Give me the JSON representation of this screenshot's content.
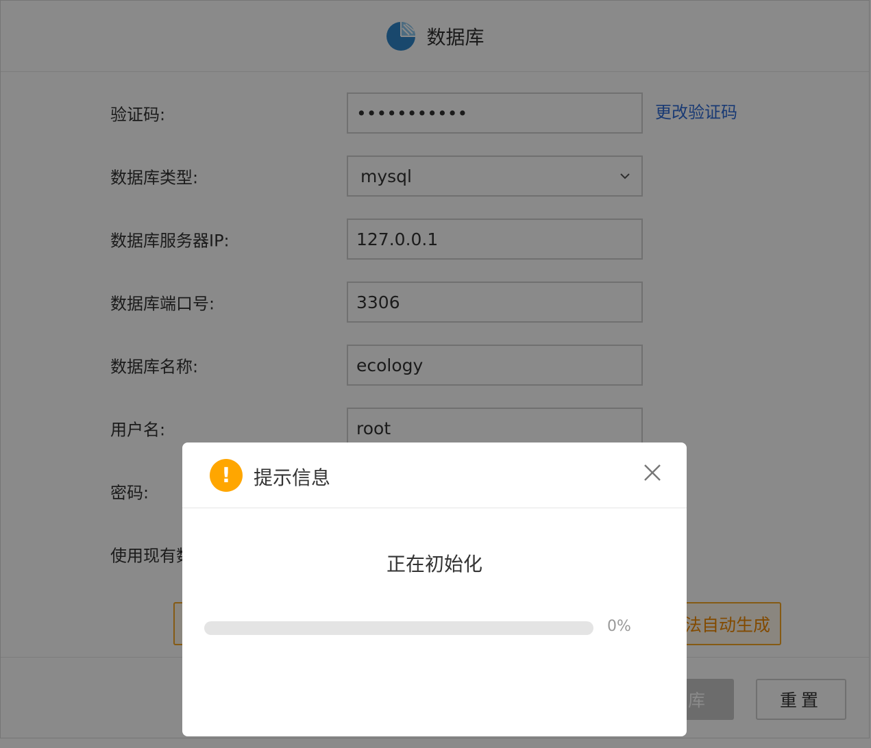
{
  "header": {
    "title": "数据库",
    "logo_icon": "database-pie-icon"
  },
  "form": {
    "verify_code": {
      "label": "验证码:",
      "value": "•••••••••••",
      "change_link": "更改验证码"
    },
    "db_type": {
      "label": "数据库类型:",
      "value": "mysql"
    },
    "server_ip": {
      "label": "数据库服务器IP:",
      "value": "127.0.0.1"
    },
    "port": {
      "label": "数据库端口号:",
      "value": "3306"
    },
    "db_name": {
      "label": "数据库名称:",
      "value": "ecology"
    },
    "username": {
      "label": "用户名:",
      "value": "root"
    },
    "password": {
      "label": "密码:",
      "value": ""
    },
    "use_existing": {
      "label": "使用现有数"
    }
  },
  "buttons": {
    "warning_partial": "法自动生成",
    "create_partial": "库",
    "reset": "重置"
  },
  "dialog": {
    "title": "提示信息",
    "message": "正在初始化",
    "progress_percent": 0,
    "progress_text": "0%",
    "warn_icon_glyph": "!"
  },
  "colors": {
    "link": "#2f6bd6",
    "warning": "#f5a623",
    "warning_icon": "#ffa600",
    "logo": "#3a9ad9"
  }
}
